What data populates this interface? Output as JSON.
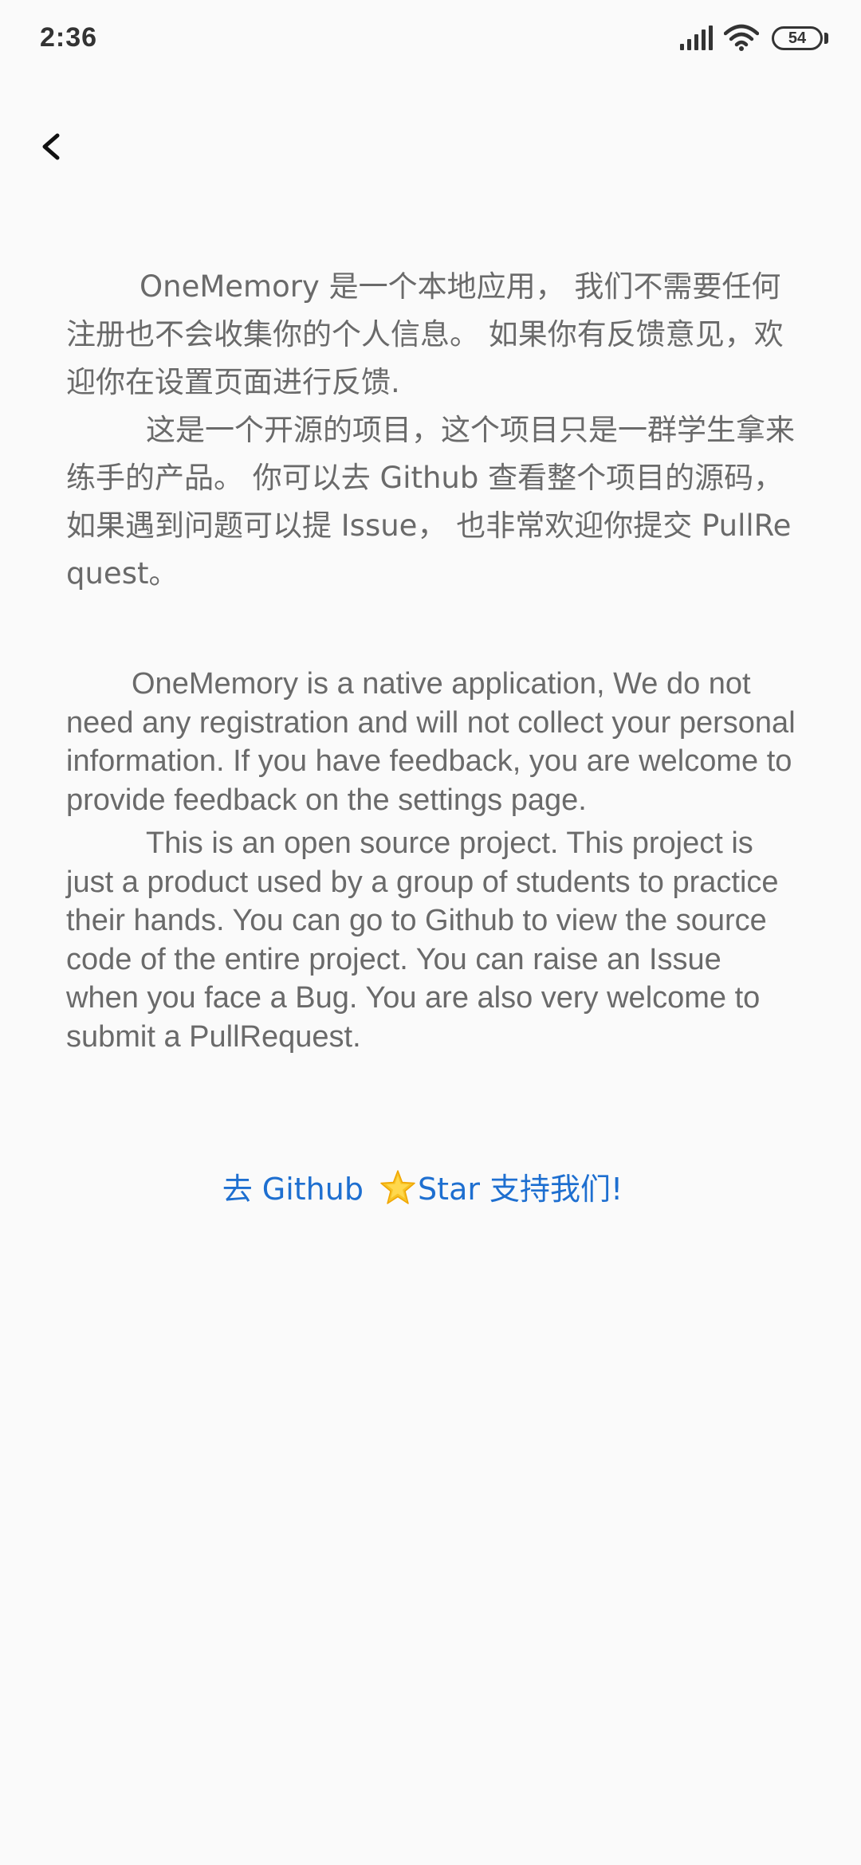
{
  "status_bar": {
    "time": "2:36",
    "battery": "54"
  },
  "navigation": {
    "back_icon": "chevron-left-icon"
  },
  "about": {
    "chinese_paragraphs": [
      "OneMemory 是一个本地应用， 我们不需要任何注册也不会收集你的个人信息。 如果你有反馈意见，欢迎你在设置页面进行反馈.",
      "这是一个开源的项目，这个项目只是一群学生拿来练手的产品。 你可以去 Github 查看整个项目的源码， 如果遇到问题可以提 Issue， 也非常欢迎你提交 PullRequest。"
    ],
    "english_paragraphs": [
      "OneMemory is a native application, We do not need any registration and will not collect your personal information. If you have feedback, you are welcome to provide feedback on the settings page.",
      "This is an open source project. This project is just a product used by a group of students to practice their hands. You can go to Github to view the source code of the entire project. You can raise an Issue when you face a Bug. You are also very welcome to submit a PullRequest."
    ]
  },
  "github_link": {
    "prefix": "去 Github ",
    "star_icon": "star-icon",
    "suffix": "Star 支持我们!"
  },
  "colors": {
    "background": "#fafafa",
    "body_text": "#6a6a6a",
    "link": "#1e6fd0",
    "star": "#f7c325"
  }
}
